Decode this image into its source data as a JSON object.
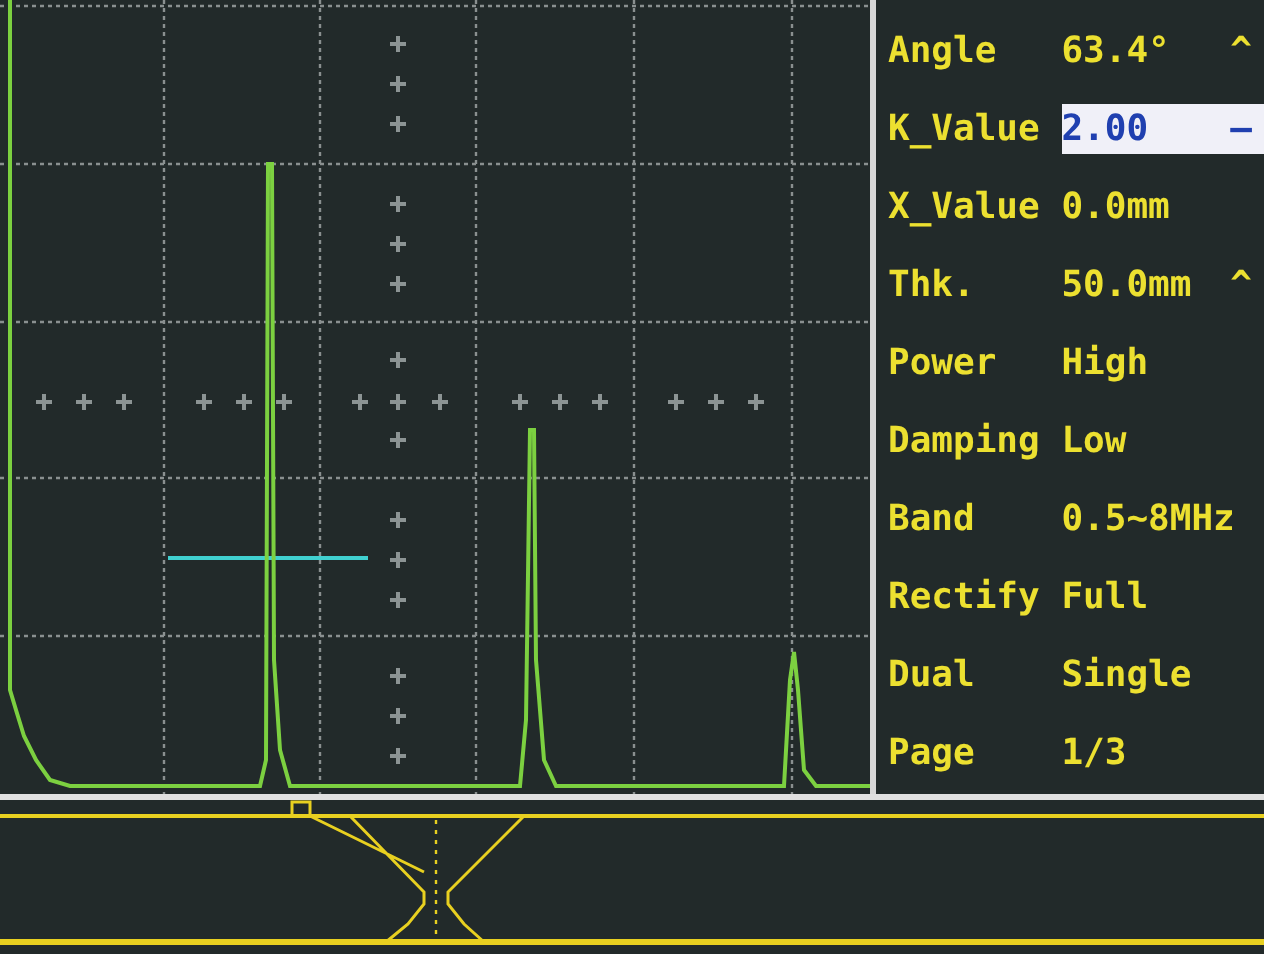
{
  "parameters": [
    {
      "label": "Angle",
      "value": "63.4°",
      "marker": "^",
      "selected": false
    },
    {
      "label": "K_Value",
      "value": "2.00",
      "marker": "–",
      "selected": true
    },
    {
      "label": "X_Value",
      "value": "0.0mm",
      "selected": false
    },
    {
      "label": "Thk.",
      "value": "50.0mm",
      "marker": "^",
      "selected": false
    },
    {
      "label": "Power",
      "value": "High",
      "selected": false
    },
    {
      "label": "Damping",
      "value": "Low",
      "selected": false
    },
    {
      "label": "Band",
      "value": "0.5~8MHz",
      "selected": false
    },
    {
      "label": "Rectify",
      "value": "Full",
      "selected": false
    },
    {
      "label": "Dual",
      "value": "Single",
      "selected": false
    },
    {
      "label": "Page",
      "value": "1/3",
      "selected": false
    }
  ]
}
